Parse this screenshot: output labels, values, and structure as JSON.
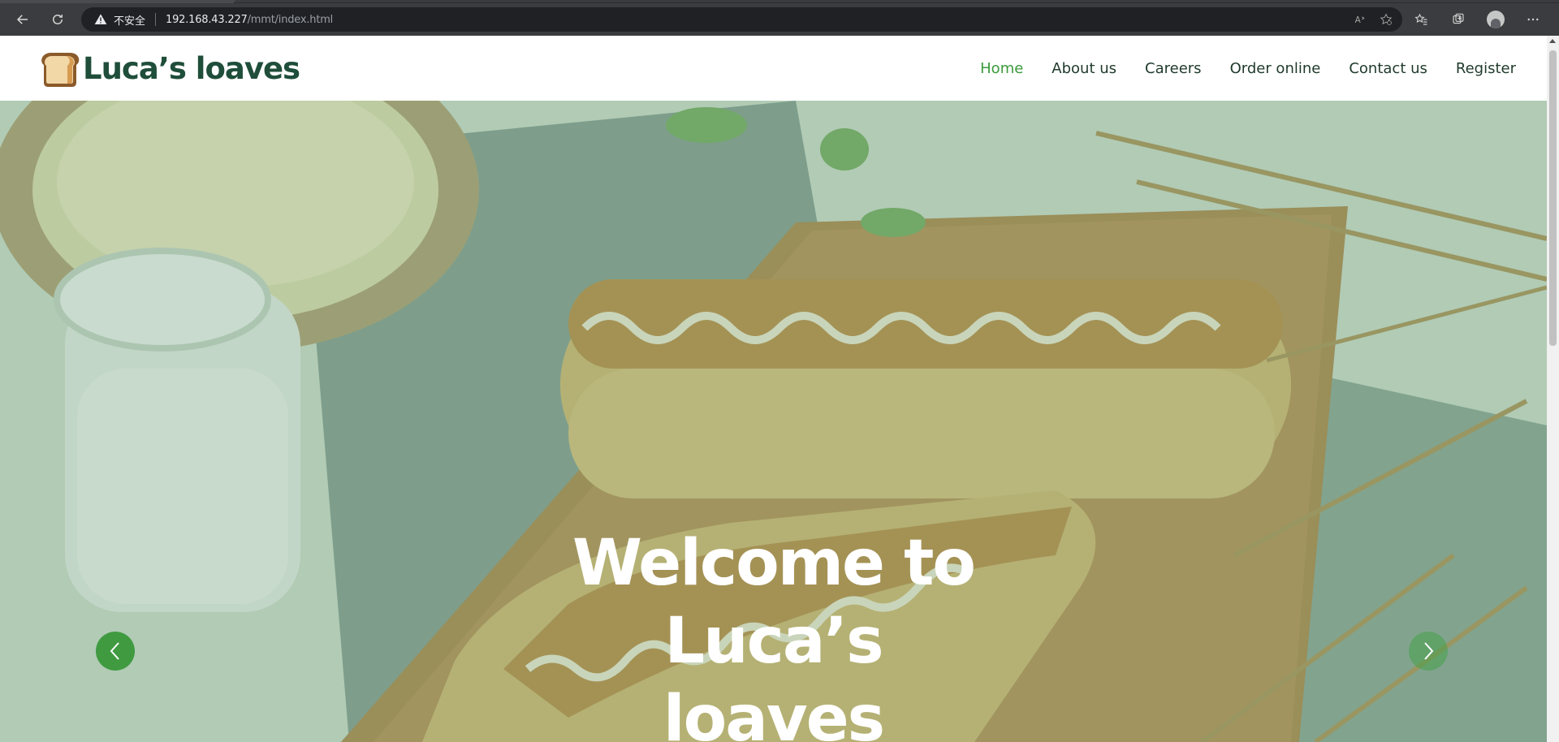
{
  "browser": {
    "security_label": "不安全",
    "url_host": "192.168.43.227",
    "url_path": "/mmt/index.html",
    "reader_icon_text": "A"
  },
  "site": {
    "logo_text": "Luca’s loaves",
    "nav": [
      {
        "label": "Home",
        "active": true
      },
      {
        "label": "About us",
        "active": false
      },
      {
        "label": "Careers",
        "active": false
      },
      {
        "label": "Order online",
        "active": false
      },
      {
        "label": "Contact us",
        "active": false
      },
      {
        "label": "Register",
        "active": false
      }
    ]
  },
  "hero": {
    "title_line1": "Welcome to Luca’s",
    "title_line2": "loaves"
  },
  "colors": {
    "brand_dark": "#1f4e3a",
    "nav_active": "#3b9a3b",
    "carousel_button": "#3f9a40"
  }
}
